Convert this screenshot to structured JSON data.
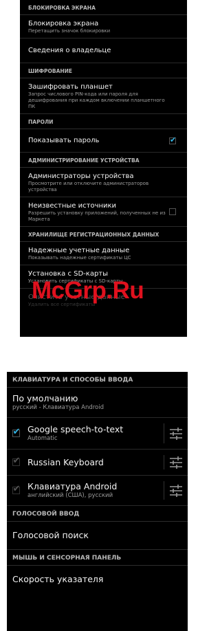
{
  "security": {
    "sections": [
      {
        "header": "БЛОКИРОВКА ЭКРАНА",
        "items": [
          {
            "title": "Блокировка экрана",
            "sub": "Перетащить значок блокировки"
          },
          {
            "title": "Сведения о владельце",
            "sub": ""
          }
        ]
      },
      {
        "header": "ШИФРОВАНИЕ",
        "items": [
          {
            "title": "Зашифровать планшет",
            "sub": "Запрос числового PIN-кода или пароля для дешифрования при каждом включении планшетного ПК"
          }
        ]
      },
      {
        "header": "ПАРОЛИ",
        "items": [
          {
            "title": "Показывать пароль",
            "sub": "",
            "checkbox": "checked"
          }
        ]
      },
      {
        "header": "АДМИНИСТРИРОВАНИЕ УСТРОЙСТВА",
        "items": [
          {
            "title": "Администраторы устройства",
            "sub": "Просмотрите или отключите администраторов устройства"
          },
          {
            "title": "Неизвестные источники",
            "sub": "Разрешить установку приложений, полученных не из Маркета",
            "checkbox": "unchecked"
          }
        ]
      },
      {
        "header": "ХРАНИЛИЩЕ РЕГИСТРАЦИОННЫХ ДАННЫХ",
        "items": [
          {
            "title": "Надежные учетные данные",
            "sub": "Показывать надежные сертификаты ЦС"
          },
          {
            "title": "Установка с SD-карты",
            "sub": "Установить сертификаты с SD-карты"
          },
          {
            "title": "Очистить учетные данные",
            "sub": "Удалить все сертификаты",
            "disabled": true
          }
        ]
      }
    ]
  },
  "watermark": "McGrp.Ru",
  "input": {
    "keyboard_header": "КЛАВИАТУРА И СПОСОБЫ ВВОДА",
    "default_title": "По умолчанию",
    "default_sub": "русский - Клавиатура Android",
    "imes": [
      {
        "title": "Google speech-to-text",
        "sub": "Automatic",
        "state": "on"
      },
      {
        "title": "Russian Keyboard",
        "sub": "",
        "state": "dim"
      },
      {
        "title": "Клавиатура Android",
        "sub": "английский (США), русский",
        "state": "dim"
      }
    ],
    "voice_header": "ГОЛОСОВОЙ ВВОД",
    "voice_search": "Голосовой поиск",
    "mouse_header": "МЫШЬ И СЕНСОРНАЯ ПАНЕЛЬ",
    "pointer_speed": "Скорость указателя"
  },
  "colors": {
    "accent": "#33b5e5",
    "watermark": "#e0111e"
  },
  "icons": {
    "ime_settings": "sliders-icon",
    "check": "checkmark-icon"
  }
}
